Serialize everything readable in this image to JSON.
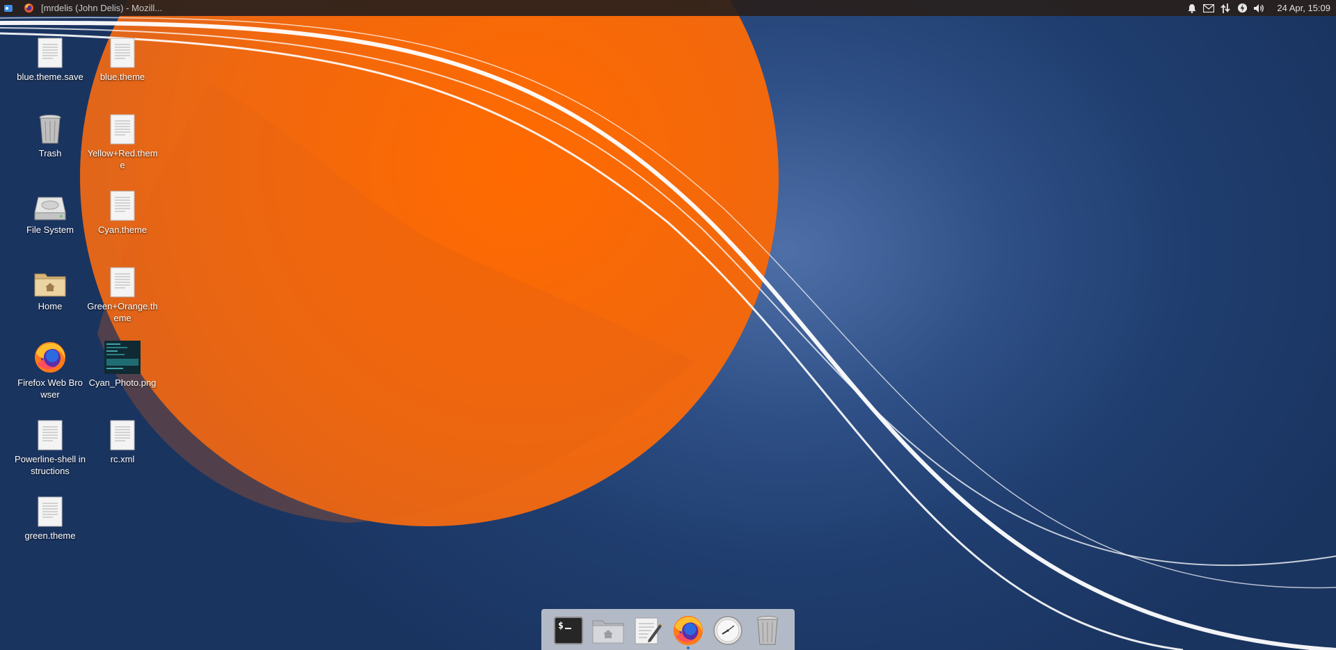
{
  "top_panel": {
    "window_title": "[mrdelis (John Delis) - Mozill...",
    "clock": "24 Apr, 15:09",
    "tray_icons": [
      "bell-icon",
      "mail-icon",
      "network-updown-icon",
      "power-icon",
      "volume-icon"
    ]
  },
  "desktop": {
    "icons": [
      {
        "label": "blue.theme.save",
        "icon": "document-icon"
      },
      {
        "label": "blue.theme",
        "icon": "document-icon"
      },
      {
        "label": "Trash",
        "icon": "trash-icon"
      },
      {
        "label": "Yellow+Red.theme",
        "icon": "document-icon"
      },
      {
        "label": "File System",
        "icon": "hard-drive-icon"
      },
      {
        "label": "Cyan.theme",
        "icon": "document-icon"
      },
      {
        "label": "Home",
        "icon": "home-folder-icon"
      },
      {
        "label": "Green+Orange.theme",
        "icon": "document-icon"
      },
      {
        "label": "Firefox Web Browser",
        "icon": "firefox-icon"
      },
      {
        "label": "Cyan_Photo.png",
        "icon": "image-thumbnail-icon"
      },
      {
        "label": "Powerline-shell instructions",
        "icon": "document-icon"
      },
      {
        "label": "rc.xml",
        "icon": "document-icon"
      },
      {
        "label": "green.theme",
        "icon": "document-icon"
      }
    ]
  },
  "dock": {
    "items": [
      {
        "name": "terminal",
        "icon": "terminal-icon"
      },
      {
        "name": "file-manager",
        "icon": "folder-home-icon"
      },
      {
        "name": "text-editor",
        "icon": "text-editor-icon"
      },
      {
        "name": "firefox",
        "icon": "firefox-icon",
        "running": true
      },
      {
        "name": "clock",
        "icon": "clock-icon"
      },
      {
        "name": "trash",
        "icon": "trash-icon"
      }
    ]
  },
  "colors": {
    "wallpaper_blue": "#1f3d6e",
    "sun_orange": "#f06a12",
    "panel_bg": "#28201c",
    "dock_bg": "#c8ccd4"
  }
}
